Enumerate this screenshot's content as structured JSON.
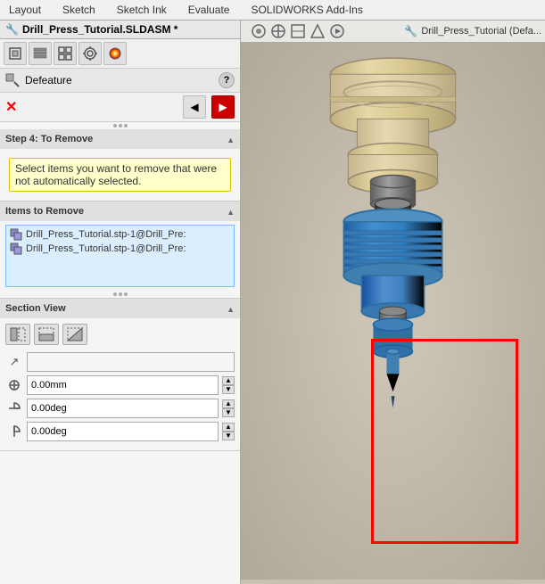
{
  "menubar": {
    "items": [
      "Layout",
      "Sketch",
      "Sketch Ink",
      "Evaluate",
      "SOLIDWORKS Add-Ins"
    ]
  },
  "filetitle": {
    "icon": "🔧",
    "name": "Drill_Press_Tutorial.SLDASM *"
  },
  "toolbar": {
    "buttons": [
      {
        "name": "cube-view",
        "icon": "⬛"
      },
      {
        "name": "list-view",
        "icon": "≡"
      },
      {
        "name": "tree-view",
        "icon": "⧉"
      },
      {
        "name": "target-view",
        "icon": "⊕"
      },
      {
        "name": "color-view",
        "icon": "◉"
      }
    ]
  },
  "panel": {
    "title": "Defeature",
    "help_label": "?",
    "close_label": "✕",
    "back_arrow": "◀",
    "next_arrow": "▶"
  },
  "step4": {
    "header": "Step 4: To Remove",
    "message": "Select items you want to remove that were not automatically selected.",
    "collapse_icon": "▲"
  },
  "items_to_remove": {
    "header": "Items to Remove",
    "collapse_icon": "▲",
    "items": [
      {
        "text": "Drill_Press_Tutorial.stp-1@Drill_Pre:"
      },
      {
        "text": "Drill_Press_Tutorial.stp-1@Drill_Pre:"
      }
    ]
  },
  "section_view": {
    "header": "Section View",
    "collapse_icon": "▲",
    "buttons": [
      {
        "name": "sv-btn1",
        "icon": "⧈"
      },
      {
        "name": "sv-btn2",
        "icon": "⧉"
      },
      {
        "name": "sv-btn3",
        "icon": "⊡"
      }
    ],
    "arrow_icon": "↗",
    "fields": [
      {
        "icon": "⊕",
        "value": "",
        "placeholder": ""
      },
      {
        "icon": "↕",
        "value": "0.00mm"
      },
      {
        "icon": "↻",
        "value": "0.00deg"
      },
      {
        "icon": "↻",
        "value": "0.00deg"
      }
    ]
  },
  "viewport": {
    "component_icon": "🔧",
    "component_name": "Drill_Press_Tutorial (Defa...",
    "toolbar_buttons": [
      "⊕",
      "⊕",
      "⊙",
      "⊙",
      "▷"
    ]
  },
  "colors": {
    "accent_red": "#cc0000",
    "selection_border": "#ff0000",
    "info_bg": "#ffffcc",
    "items_bg": "#daeeff",
    "items_border": "#7abcff"
  }
}
